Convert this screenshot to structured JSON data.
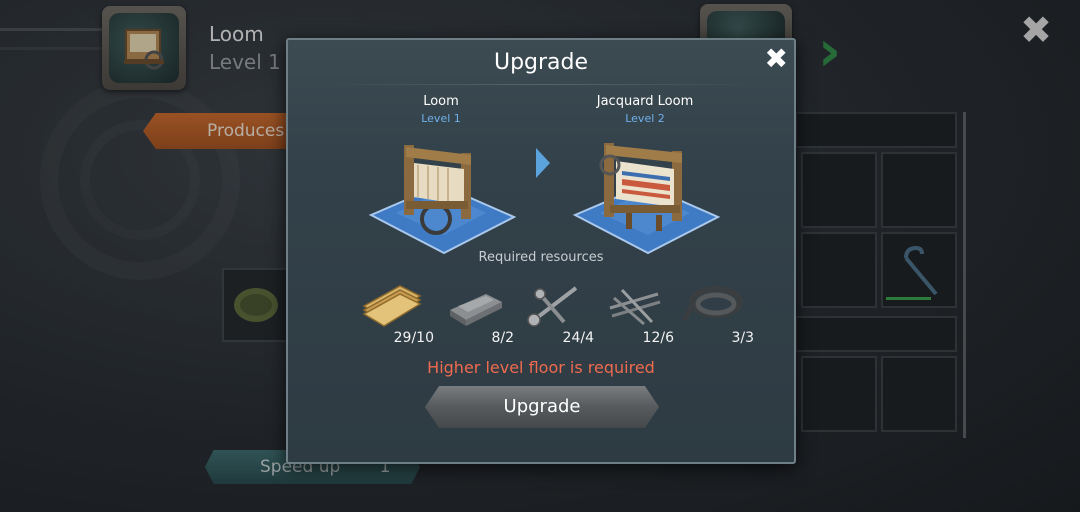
{
  "header": {
    "building_name": "Loom",
    "building_level": "Level 1",
    "close_icon": "close-icon"
  },
  "left_panel": {
    "produces_label": "Produces",
    "speed_up_label": "Speed up",
    "speed_up_count": "1"
  },
  "modal": {
    "title": "Upgrade",
    "current": {
      "name": "Loom",
      "level": "Level 1"
    },
    "next": {
      "name": "Jacquard Loom",
      "level": "Level 2"
    },
    "required_label": "Required resources",
    "resources": [
      {
        "icon": "planks-icon",
        "count": "29/10"
      },
      {
        "icon": "metal-ingot-icon",
        "count": "8/2"
      },
      {
        "icon": "screws-icon",
        "count": "24/4"
      },
      {
        "icon": "nails-icon",
        "count": "12/6"
      },
      {
        "icon": "hose-icon",
        "count": "3/3"
      }
    ],
    "warning": "Higher level floor is required",
    "upgrade_button": "Upgrade"
  },
  "colors": {
    "accent_blue": "#6fb0ea",
    "warning_red": "#f06a4f",
    "nav_green": "#2f8a45",
    "produces_orange": "#c9692a"
  }
}
